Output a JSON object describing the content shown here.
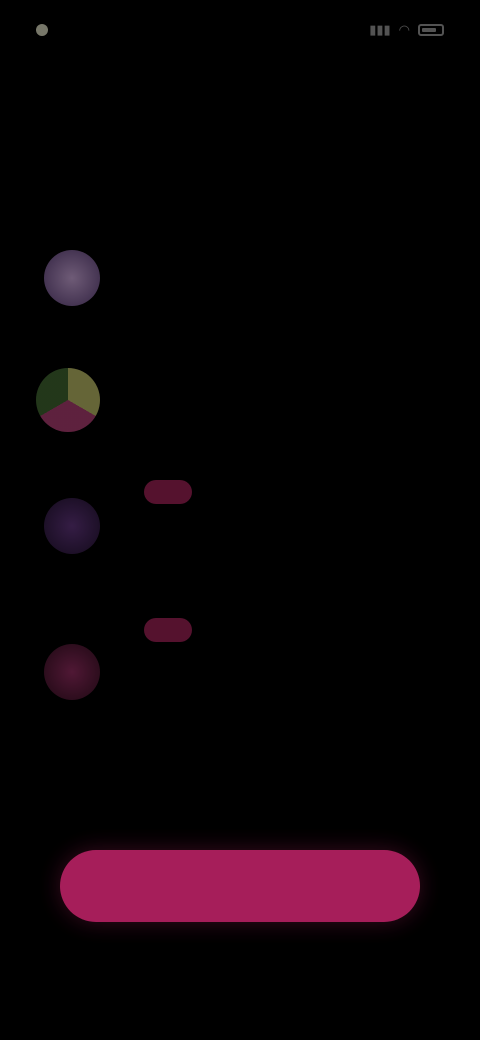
{
  "status_bar": {
    "time": "",
    "signal_icon": "signal-icon",
    "wifi_icon": "wifi-icon",
    "battery_icon": "battery-icon"
  },
  "title": "",
  "features": [
    {
      "icon": "feature-1-icon",
      "title": "",
      "desc": "",
      "badge": ""
    },
    {
      "icon": "feature-2-icon",
      "title": "",
      "desc": "",
      "badge": ""
    },
    {
      "icon": "feature-3-icon",
      "title": "",
      "desc": "",
      "badge": ""
    },
    {
      "icon": "feature-4-icon",
      "title": "",
      "desc": "",
      "badge": ""
    }
  ],
  "learn_more": "",
  "cta": {
    "label": ""
  },
  "disclaimer": "",
  "bottom_link": "",
  "colors": {
    "background": "#000000",
    "accent": "#c4246a",
    "badge": "#e0307a",
    "link": "#3a7bd5"
  }
}
